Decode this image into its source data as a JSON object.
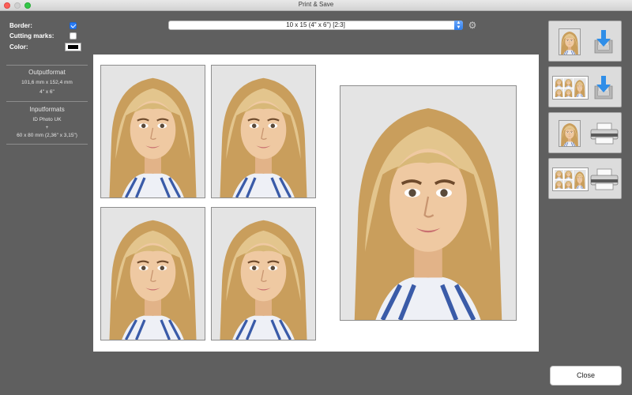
{
  "window": {
    "title": "Print & Save"
  },
  "options": {
    "border_label": "Border:",
    "border_checked": true,
    "cutting_marks_label": "Cutting marks:",
    "cutting_marks_checked": false,
    "color_label": "Color:",
    "color_value": "#000000"
  },
  "outputformat": {
    "heading": "Outputformat",
    "size_mm": "101,6 mm x 152,4 mm",
    "size_in": "4\" x 6\""
  },
  "inputformats": {
    "heading": "Inputformats",
    "name": "ID Photo UK",
    "plus": "+",
    "size": "60 x 80 mm (2,36\" x 3,15\")"
  },
  "format_select": {
    "selected": "10 x 15 (4\" x 6\") [2:3]"
  },
  "preview": {
    "photo_count_small": 4,
    "photo_count_large": 1
  },
  "actions": [
    {
      "name": "save-single-button",
      "icon": "download-icon"
    },
    {
      "name": "save-sheet-button",
      "icon": "download-icon"
    },
    {
      "name": "print-single-button",
      "icon": "printer-icon"
    },
    {
      "name": "print-sheet-button",
      "icon": "printer-icon"
    }
  ],
  "close_label": "Close",
  "colors": {
    "accent": "#2a7cf5",
    "background": "#5f5f5f",
    "download_blue": "#2f8ee8"
  }
}
